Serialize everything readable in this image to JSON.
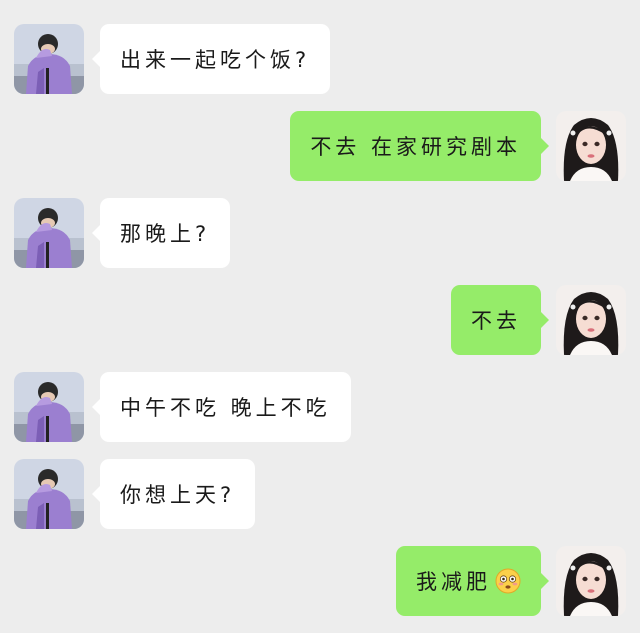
{
  "conversation": {
    "messages": [
      {
        "sender": "friend",
        "text": "出来一起吃个饭?"
      },
      {
        "sender": "me",
        "text": "不去 在家研究剧本"
      },
      {
        "sender": "friend",
        "text": "那晚上?"
      },
      {
        "sender": "me",
        "text": "不去"
      },
      {
        "sender": "friend",
        "text": "中午不吃 晚上不吃"
      },
      {
        "sender": "friend",
        "text": "你想上天?"
      },
      {
        "sender": "me",
        "text": "我减肥",
        "emoji": "flushed-face-emoji"
      }
    ]
  },
  "colors": {
    "background": "#ededed",
    "incoming_bubble": "#ffffff",
    "outgoing_bubble": "#95ec69"
  },
  "icons": {
    "friend_avatar": "boy-purple-hoodie-avatar",
    "my_avatar": "girl-portrait-avatar"
  }
}
